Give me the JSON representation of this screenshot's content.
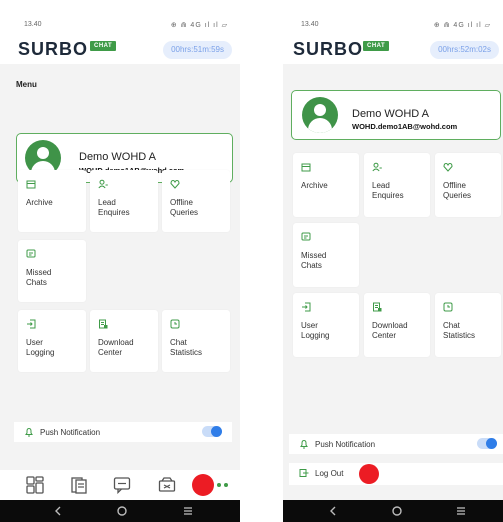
{
  "status_bar": {
    "time_left": "13.40",
    "time_right": "13.40",
    "icons_text": "⊕ ⋒ 4G ıl ıl ▱"
  },
  "header": {
    "logo": "SURBO",
    "logo_badge": "CHAT",
    "timer_left": "00hrs:51m:59s",
    "timer_right": "00hrs:52m:02s"
  },
  "menu": {
    "title": "Menu"
  },
  "profile": {
    "name": "Demo WOHD A",
    "email": "WOHD.demo1AB@wohd.com"
  },
  "tiles": [
    {
      "label": "Archive",
      "icon": "archive-icon"
    },
    {
      "label": "Lead Enquires",
      "icon": "user-add-icon"
    },
    {
      "label": "Offline Queries",
      "icon": "heart-shield-icon"
    },
    {
      "label": "Missed Chats",
      "icon": "missed-chat-icon"
    },
    {
      "label": "User Logging",
      "icon": "login-icon"
    },
    {
      "label": "Download Center",
      "icon": "download-doc-icon"
    },
    {
      "label": "Chat Statistics",
      "icon": "statistics-icon"
    }
  ],
  "settings": {
    "push_notification_label": "Push Notification",
    "push_notification_on": true,
    "logout_label": "Log Out"
  },
  "tabbar": {
    "icons": [
      "dashboard-icon",
      "documents-icon",
      "chat-icon",
      "ticket-icon"
    ]
  },
  "colors": {
    "brand_green": "#3f9b48",
    "timer_text": "#7aa0e8",
    "toggle_blue": "#2f7de8",
    "record_red": "#ec1c24"
  }
}
